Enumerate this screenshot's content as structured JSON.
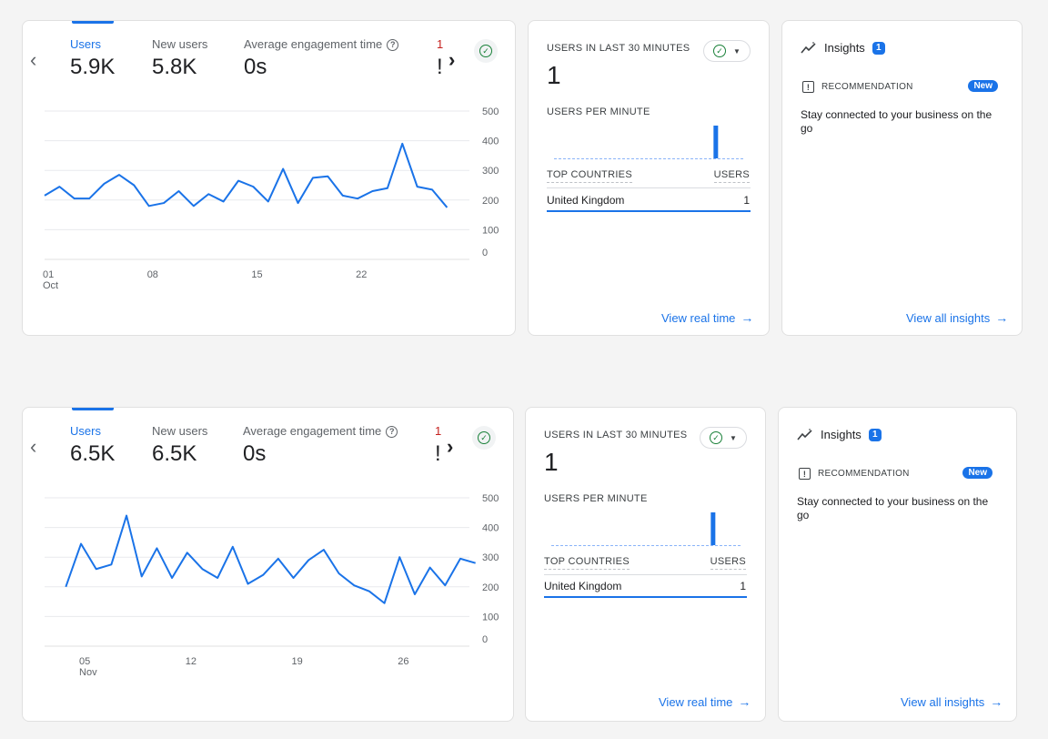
{
  "panels": [
    {
      "metrics": [
        {
          "label": "Users",
          "value": "5.9K"
        },
        {
          "label": "New users",
          "value": "5.8K"
        },
        {
          "label": "Average engagement time",
          "value": "0s"
        }
      ],
      "clipped_metric_first_char": "1",
      "clipped_metric_value_char": "!",
      "prev_icon": "chevron-left-icon",
      "next_icon": "chevron-right-icon",
      "chart_data": {
        "type": "line",
        "x": [
          1,
          2,
          3,
          4,
          5,
          6,
          7,
          8,
          9,
          10,
          11,
          12,
          13,
          14,
          15,
          16,
          17,
          18,
          19,
          20,
          21,
          22,
          23,
          24,
          25,
          26,
          27,
          28,
          29,
          30,
          31
        ],
        "values": [
          215,
          245,
          205,
          205,
          255,
          285,
          250,
          180,
          190,
          230,
          180,
          220,
          195,
          265,
          245,
          195,
          305,
          190,
          275,
          280,
          215,
          205,
          230,
          240,
          390,
          245,
          235,
          175
        ],
        "ylim": [
          0,
          500
        ],
        "y_ticks": [
          "500",
          "400",
          "300",
          "200",
          "100",
          "0"
        ],
        "x_ticks": [
          {
            "day": 1,
            "label": "01",
            "sub": "Oct"
          },
          {
            "day": 8,
            "label": "08",
            "sub": ""
          },
          {
            "day": 15,
            "label": "15",
            "sub": ""
          },
          {
            "day": 22,
            "label": "22",
            "sub": ""
          }
        ],
        "x_range": [
          1,
          29.5
        ],
        "line_color": "#1a73e8"
      },
      "realtime": {
        "title": "USERS IN LAST 30 MINUTES",
        "count": "1",
        "per_minute_label": "USERS PER MINUTE",
        "per_minute_values": [
          0,
          0,
          0,
          0,
          0,
          0,
          0,
          0,
          0,
          0,
          0,
          0,
          0,
          0,
          0,
          0,
          0,
          0,
          0,
          0,
          0,
          0,
          0,
          0,
          0,
          1,
          0,
          0,
          0,
          0
        ],
        "countries_header": "TOP COUNTRIES",
        "users_header": "USERS",
        "rows": [
          {
            "country": "United Kingdom",
            "users": "1"
          }
        ],
        "link": "View real time"
      },
      "insights": {
        "title": "Insights",
        "count": "1",
        "recommendation_label": "RECOMMENDATION",
        "new_badge": "New",
        "text": "Stay connected to your business on the go",
        "link": "View all insights"
      }
    },
    {
      "metrics": [
        {
          "label": "Users",
          "value": "6.5K"
        },
        {
          "label": "New users",
          "value": "6.5K"
        },
        {
          "label": "Average engagement time",
          "value": "0s"
        }
      ],
      "clipped_metric_first_char": "1",
      "clipped_metric_value_char": "!",
      "prev_icon": "chevron-left-icon",
      "next_icon": "chevron-right-icon",
      "chart_data": {
        "type": "line",
        "x": [
          4,
          5,
          6,
          7,
          8,
          9,
          10,
          11,
          12,
          13,
          14,
          15,
          16,
          17,
          18,
          19,
          20,
          21,
          22,
          23,
          24,
          25,
          26,
          27,
          28,
          29,
          30,
          31,
          32
        ],
        "values": [
          200,
          345,
          260,
          275,
          440,
          235,
          330,
          230,
          315,
          260,
          230,
          335,
          210,
          240,
          295,
          230,
          290,
          325,
          245,
          205,
          185,
          145,
          300,
          175,
          265,
          205,
          295,
          280
        ],
        "ylim": [
          0,
          500
        ],
        "y_ticks": [
          "500",
          "400",
          "300",
          "200",
          "100",
          "0"
        ],
        "x_ticks": [
          {
            "day": 5,
            "label": "05",
            "sub": "Nov"
          },
          {
            "day": 12,
            "label": "12",
            "sub": ""
          },
          {
            "day": 19,
            "label": "19",
            "sub": ""
          },
          {
            "day": 26,
            "label": "26",
            "sub": ""
          }
        ],
        "x_range": [
          2.6,
          30.6
        ],
        "line_color": "#1a73e8"
      },
      "realtime": {
        "title": "USERS IN LAST 30 MINUTES",
        "count": "1",
        "per_minute_label": "USERS PER MINUTE",
        "per_minute_values": [
          0,
          0,
          0,
          0,
          0,
          0,
          0,
          0,
          0,
          0,
          0,
          0,
          0,
          0,
          0,
          0,
          0,
          0,
          0,
          0,
          0,
          0,
          0,
          0,
          0,
          1,
          0,
          0,
          0,
          0
        ],
        "countries_header": "TOP COUNTRIES",
        "users_header": "USERS",
        "rows": [
          {
            "country": "United Kingdom",
            "users": "1"
          }
        ],
        "link": "View real time"
      },
      "insights": {
        "title": "Insights",
        "count": "1",
        "recommendation_label": "RECOMMENDATION",
        "new_badge": "New",
        "text": "Stay connected to your business on the go",
        "link": "View all insights"
      }
    }
  ],
  "colors": {
    "accent": "#1a73e8",
    "success": "#188038",
    "text": "#202124",
    "muted": "#5f6368"
  }
}
